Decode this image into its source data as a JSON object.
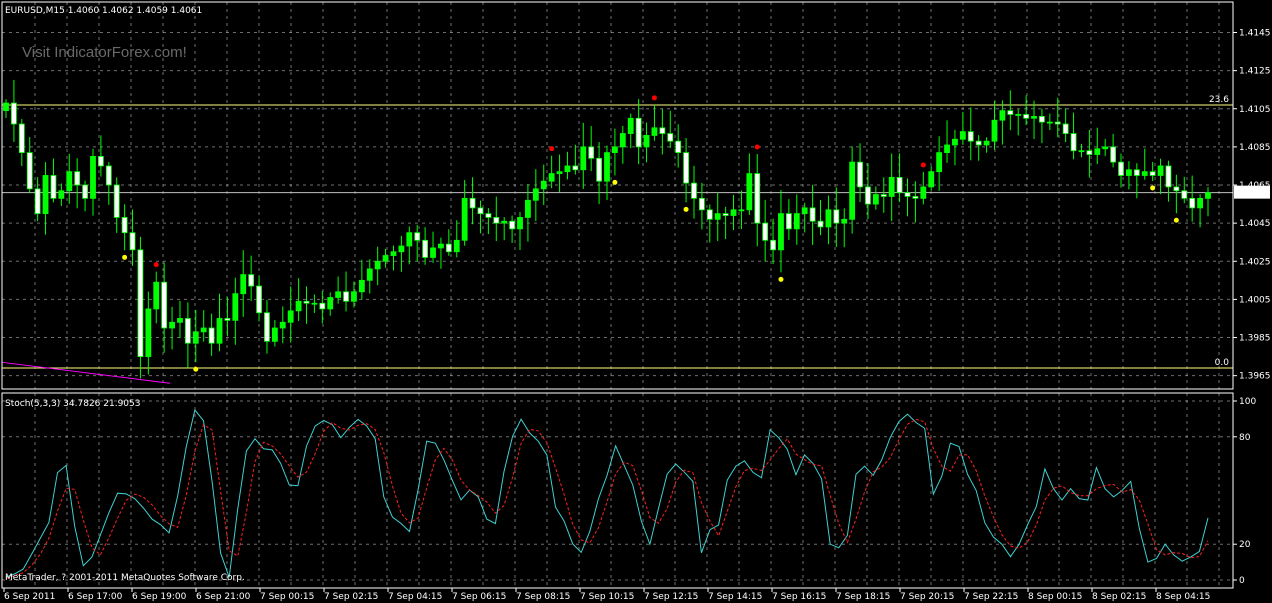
{
  "main_header": {
    "text": "EURUSD,M15  1.4060 1.4062 1.4059 1.4061"
  },
  "watermark": "Visit IndicatorForex.com!",
  "sub_header": {
    "text": "Stoch(5,3,3) 34.7826 21.9053"
  },
  "copyright": "MetaTrader, ? 2001-2011 MetaQuotes Software Corp.",
  "colors": {
    "background": "#000000",
    "grid": "#c8c8c8",
    "axis": "#ffffff",
    "bull": "#ffffff",
    "bear": "#00ff00",
    "fib": "#ffff80",
    "current_price": "#c0c0c0",
    "stoch_main": "#3fd0d0",
    "stoch_signal": "#ff2020",
    "dot_high": "#ff0000",
    "dot_low": "#ffff00",
    "trendline": "#ff00ff"
  },
  "price_axis": {
    "ticks": [
      "1.4145",
      "1.4125",
      "1.4105",
      "1.4085",
      "1.4065",
      "1.4045",
      "1.4025",
      "1.4005",
      "1.3985",
      "1.3965"
    ],
    "current_label": "1.4061"
  },
  "stoch_axis": {
    "ticks": [
      "100",
      "80",
      "20",
      "0"
    ]
  },
  "time_axis": {
    "labels": [
      "6 Sep 2011",
      "6 Sep 17:00",
      "6 Sep 19:00",
      "6 Sep 21:00",
      "7 Sep 00:15",
      "7 Sep 02:15",
      "7 Sep 04:15",
      "7 Sep 06:15",
      "7 Sep 08:15",
      "7 Sep 10:15",
      "7 Sep 12:15",
      "7 Sep 14:15",
      "7 Sep 16:15",
      "7 Sep 18:15",
      "7 Sep 20:15",
      "7 Sep 22:15",
      "8 Sep 00:15",
      "8 Sep 02:15",
      "8 Sep 04:15"
    ]
  },
  "fib_levels": [
    {
      "label": "23.6",
      "price": 1.4107
    },
    {
      "label": "0.0",
      "price": 1.3969
    }
  ],
  "chart_data": [
    {
      "type": "candlestick",
      "title": "EURUSD,M15",
      "ylim": [
        1.3958,
        1.4161
      ],
      "current_price": 1.4061,
      "close": [
        1.4108,
        1.4097,
        1.4082,
        1.4063,
        1.405,
        1.407,
        1.4058,
        1.4062,
        1.4072,
        1.4065,
        1.4058,
        1.408,
        1.4075,
        1.4065,
        1.4048,
        1.404,
        1.4031,
        1.3975,
        1.4,
        1.4014,
        1.399,
        1.3993,
        1.3995,
        1.3982,
        1.3988,
        1.399,
        1.3982,
        1.3995,
        1.3994,
        1.4008,
        1.4018,
        1.4012,
        1.3998,
        1.3983,
        1.399,
        1.3993,
        1.3999,
        1.4004,
        1.4003,
        1.4003,
        1.4,
        1.4006,
        1.4009,
        1.4004,
        1.4009,
        1.4015,
        1.4021,
        1.4025,
        1.4028,
        1.403,
        1.4033,
        1.404,
        1.4036,
        1.4027,
        1.4032,
        1.4034,
        1.403,
        1.4036,
        1.4058,
        1.4053,
        1.405,
        1.4048,
        1.4045,
        1.4046,
        1.4042,
        1.4048,
        1.4057,
        1.4063,
        1.4067,
        1.4071,
        1.4072,
        1.4075,
        1.4073,
        1.4085,
        1.4079,
        1.4067,
        1.4082,
        1.4085,
        1.4092,
        1.41,
        1.4085,
        1.4091,
        1.4095,
        1.4092,
        1.4088,
        1.4082,
        1.4066,
        1.4058,
        1.4052,
        1.4047,
        1.405,
        1.4049,
        1.4052,
        1.4052,
        1.4071,
        1.4045,
        1.4036,
        1.4031,
        1.405,
        1.4042,
        1.405,
        1.4053,
        1.4046,
        1.4043,
        1.4052,
        1.4045,
        1.4047,
        1.4077,
        1.4064,
        1.4055,
        1.406,
        1.4059,
        1.4069,
        1.4061,
        1.4059,
        1.4058,
        1.4064,
        1.4072,
        1.4082,
        1.4086,
        1.4089,
        1.4093,
        1.4088,
        1.4086,
        1.4088,
        1.4099,
        1.4104,
        1.4102,
        1.4102,
        1.41,
        1.4101,
        1.4098,
        1.4098,
        1.4097,
        1.4092,
        1.4083,
        1.4083,
        1.4081,
        1.4084,
        1.4085,
        1.4077,
        1.407,
        1.4073,
        1.407,
        1.4072,
        1.407,
        1.4075,
        1.4064,
        1.4062,
        1.4058,
        1.4053,
        1.4058,
        1.4061
      ]
    },
    {
      "type": "line",
      "title": "Stoch(5,3,3)",
      "ylim": [
        0,
        100
      ],
      "levels": [
        20,
        80
      ],
      "series": [
        {
          "values": [
            1.6,
            3.4,
            6.1,
            14.6,
            23.3,
            32.1,
            60.0,
            64.0,
            30.0,
            8.0,
            12.8,
            25.1,
            37.7,
            48.5,
            48.1,
            45.4,
            40.2,
            34.0,
            30.9,
            26.3,
            47.1,
            74.6,
            95.0,
            89.0,
            55.0,
            15.0,
            1.5,
            40.0,
            72.1,
            78.9,
            73.3,
            72.7,
            65.1,
            53.1,
            52.7,
            74.8,
            86.0,
            89.1,
            86.8,
            79.5,
            85.3,
            89.7,
            86.1,
            78.9,
            46.4,
            35.2,
            31.6,
            27.1,
            50.5,
            77.6,
            76.4,
            67.1,
            55.5,
            44.8,
            50.2,
            46.5,
            34.0,
            31.5,
            60.6,
            80.3,
            89.9,
            82.1,
            77.5,
            69.8,
            40.7,
            32.9,
            20.2,
            15.4,
            27.1,
            45.3,
            58.4,
            75.0,
            64.0,
            53.0,
            33.0,
            20.0,
            40.0,
            59.1,
            64.8,
            60.2,
            55.1,
            15.2,
            28.1,
            30.8,
            55.7,
            63.6,
            66.6,
            60.1,
            57.1,
            83.9,
            79.5,
            73.0,
            58.8,
            69.9,
            65.1,
            56.5,
            20.0,
            18.0,
            25.0,
            59.1,
            63.6,
            58.5,
            67.1,
            79.7,
            88.5,
            92.6,
            88.0,
            84.7,
            48.0,
            58.0,
            76.4,
            74.6,
            59.0,
            50.0,
            32.0,
            24.0,
            20.0,
            13.0,
            20.0,
            31.0,
            41.0,
            62.0,
            51.0,
            44.7,
            51.0,
            45.5,
            44.7,
            62.8,
            51.0,
            46.4,
            50.0,
            55.1,
            28.9,
            10.0,
            12.0,
            20.0,
            14.0,
            10.5,
            12.9,
            16.0,
            34.7
          ]
        },
        {
          "values": [
            0.9,
            2.5,
            4.0,
            8.3,
            14.4,
            23.3,
            38.5,
            51.2,
            50.6,
            33.6,
            18.1,
            14.0,
            23.7,
            34.5,
            44.5,
            48.0,
            46.3,
            42.0,
            36.0,
            31.4,
            29.4,
            47.4,
            72.0,
            86.7,
            83.8,
            49.8,
            16.3,
            13.4,
            37.9,
            66.2,
            76.9,
            74.9,
            70.4,
            63.7,
            57.5,
            60.2,
            70.5,
            83.1,
            88.0,
            84.8,
            83.8,
            86.4,
            87.4,
            84.1,
            71.2,
            52.7,
            37.5,
            31.9,
            34.5,
            51.6,
            67.1,
            73.6,
            66.9,
            55.8,
            50.2,
            47.2,
            43.6,
            37.3,
            41.6,
            57.3,
            76.3,
            84.2,
            83.3,
            76.7,
            62.6,
            47.8,
            31.1,
            22.4,
            20.8,
            29.1,
            43.5,
            59.3,
            65.8,
            63.9,
            50.1,
            35.0,
            31.7,
            39.9,
            54.7,
            61.4,
            59.9,
            43.3,
            32.9,
            24.7,
            38.2,
            52.0,
            61.1,
            62.4,
            61.2,
            67.0,
            73.4,
            78.8,
            70.4,
            67.2,
            64.5,
            63.8,
            47.2,
            31.5,
            21.0,
            34.0,
            49.2,
            60.4,
            63.1,
            68.4,
            78.4,
            87.0,
            89.7,
            88.4,
            73.6,
            63.6,
            60.8,
            69.7,
            70.0,
            61.2,
            47.0,
            35.3,
            25.3,
            19.0,
            17.7,
            21.3,
            30.7,
            44.7,
            51.3,
            52.6,
            48.9,
            47.1,
            47.1,
            51.0,
            52.8,
            53.4,
            49.1,
            50.5,
            44.8,
            31.3,
            17.0,
            14.0,
            15.3,
            14.8,
            12.5,
            13.1,
            21.9
          ]
        }
      ]
    }
  ]
}
